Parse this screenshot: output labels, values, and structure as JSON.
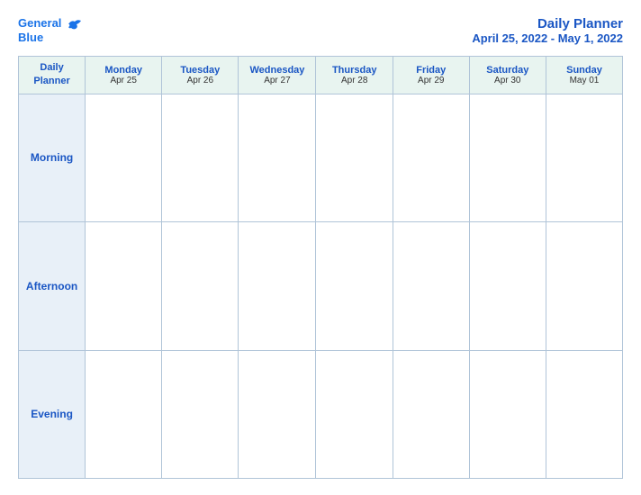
{
  "header": {
    "logo": {
      "line1": "General",
      "line2": "Blue"
    },
    "title": "Daily Planner",
    "date_range": "April 25, 2022 - May 1, 2022"
  },
  "table": {
    "first_col_label": "Daily Planner",
    "days": [
      {
        "name": "Monday",
        "date": "Apr 25"
      },
      {
        "name": "Tuesday",
        "date": "Apr 26"
      },
      {
        "name": "Wednesday",
        "date": "Apr 27"
      },
      {
        "name": "Thursday",
        "date": "Apr 28"
      },
      {
        "name": "Friday",
        "date": "Apr 29"
      },
      {
        "name": "Saturday",
        "date": "Apr 30"
      },
      {
        "name": "Sunday",
        "date": "May 01"
      }
    ],
    "rows": [
      {
        "label": "Morning"
      },
      {
        "label": "Afternoon"
      },
      {
        "label": "Evening"
      }
    ]
  }
}
